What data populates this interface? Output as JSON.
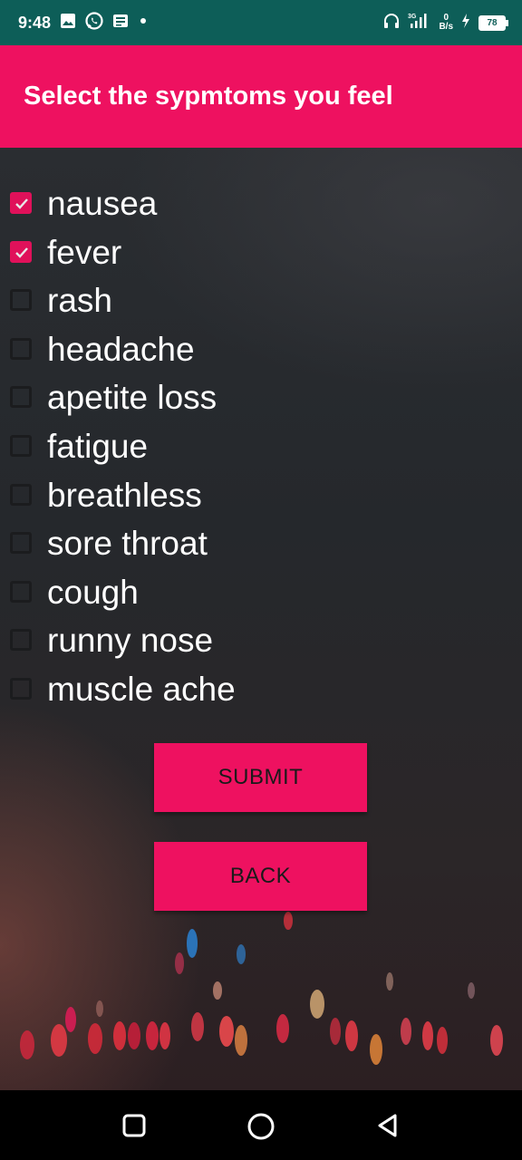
{
  "status_bar": {
    "time": "9:48",
    "net_speed_value": "0",
    "net_speed_unit": "B/s",
    "network_type": "3G",
    "battery": "78"
  },
  "app_bar": {
    "title": "Select the sypmtoms you feel"
  },
  "symptoms": [
    {
      "label": "nausea",
      "checked": true
    },
    {
      "label": "fever",
      "checked": true
    },
    {
      "label": "rash",
      "checked": false
    },
    {
      "label": "headache",
      "checked": false
    },
    {
      "label": "apetite loss",
      "checked": false
    },
    {
      "label": "fatigue",
      "checked": false
    },
    {
      "label": "breathless",
      "checked": false
    },
    {
      "label": "sore throat",
      "checked": false
    },
    {
      "label": "cough",
      "checked": false
    },
    {
      "label": "runny nose",
      "checked": false
    },
    {
      "label": "muscle ache",
      "checked": false
    }
  ],
  "buttons": {
    "submit_label": "SUBMIT",
    "back_label": "BACK"
  },
  "colors": {
    "accent": "#ee1160",
    "status_bar": "#0d5e58",
    "nav_bar": "#000000"
  }
}
